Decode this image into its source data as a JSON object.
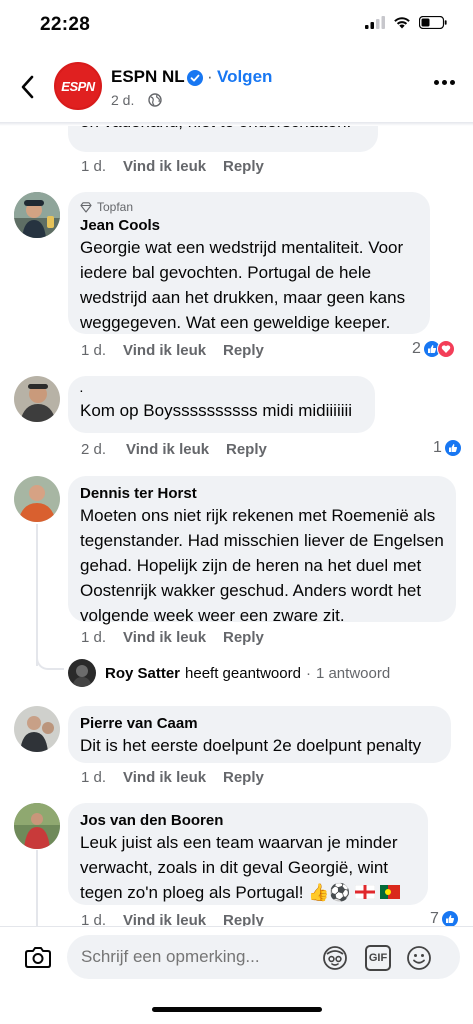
{
  "status": {
    "time": "22:28"
  },
  "header": {
    "page_name": "ESPN NL",
    "follow_label": "Volgen",
    "time": "2 d.",
    "separator": "·",
    "logo_text": "ESPN"
  },
  "actions": {
    "like_label": "Vind ik leuk",
    "reply_label": "Reply"
  },
  "comments": [
    {
      "text_tail": "en vaderland, niet te onderschatten.",
      "time": "1 d."
    },
    {
      "badge": "Topfan",
      "name": "Jean Cools",
      "text": "Georgie wat een wedstrijd mentaliteit. Voor iedere bal gevochten. Portugal de hele wedstrijd aan het drukken, maar geen kans weggegeven. Wat een geweldige keeper.",
      "time": "1 d.",
      "reaction_count": "2"
    },
    {
      "name": "",
      "name_mark": ".",
      "text": "Kom op Boyssssssssss midi midiiiiiii",
      "time": "2 d.",
      "reaction_count": "1"
    },
    {
      "name": "Dennis ter Horst",
      "text": "Moeten ons niet rijk rekenen met Roemenië als tegenstander. Had misschien liever de Engelsen gehad. Hopelijk zijn de heren na het duel met Oostenrijk wakker geschud. Anders wordt het volgende week weer een zware zit.",
      "time": "1 d."
    },
    {
      "name": "Pierre van Caam",
      "text": "Dit is het eerste doelpunt 2e doelpunt penalty",
      "time": "1 d."
    },
    {
      "name": "Jos van den Booren",
      "text": "Leuk juist als een team waarvan je minder verwacht, zoals in dit geval Georgië, wint tegen zo'n ploeg als Portugal!",
      "emoji": "👍⚽",
      "time": "1 d.",
      "reaction_count": "7"
    }
  ],
  "reply_summary": {
    "name": "Roy Satter",
    "action": "heeft geantwoord",
    "dot": "·",
    "count": "1 antwoord"
  },
  "composer": {
    "placeholder": "Schrijf een opmerking...",
    "gif_label": "GIF"
  },
  "colors": {
    "accent": "#1877f2",
    "love": "#f33e58",
    "bubble": "#f0f2f5",
    "espn_red": "#e02020"
  }
}
